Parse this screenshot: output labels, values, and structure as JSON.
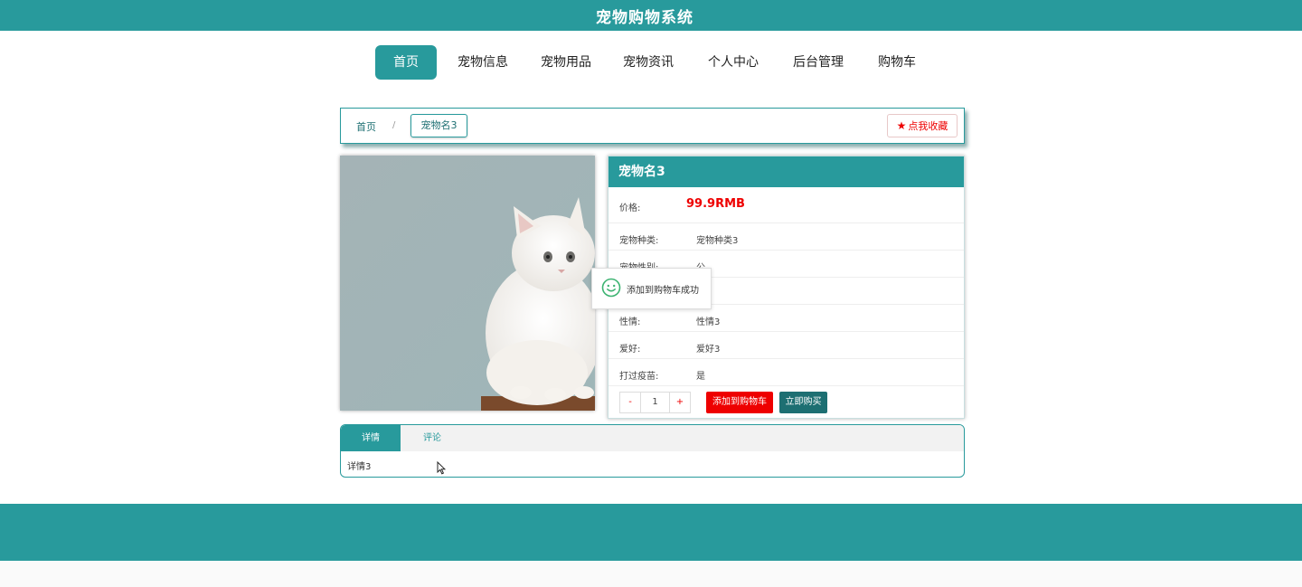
{
  "app": {
    "title": "宠物购物系统"
  },
  "nav": {
    "items": [
      {
        "label": "首页",
        "active": true
      },
      {
        "label": "宠物信息"
      },
      {
        "label": "宠物用品"
      },
      {
        "label": "宠物资讯"
      },
      {
        "label": "个人中心"
      },
      {
        "label": "后台管理"
      },
      {
        "label": "购物车"
      }
    ]
  },
  "breadcrumb": {
    "home": "首页",
    "separator": "/",
    "current": "宠物名3"
  },
  "favorite": {
    "label": "点我收藏",
    "icon": "star-icon"
  },
  "product": {
    "name": "宠物名3",
    "price_label": "价格:",
    "price_value": "99.9RMB",
    "attributes": [
      {
        "key": "宠物种类:",
        "value": "宠物种类3"
      },
      {
        "key": "宠物性别:",
        "value": "公"
      },
      {
        "key": "",
        "value": ""
      },
      {
        "key": "性情:",
        "value": "性情3"
      },
      {
        "key": "爱好:",
        "value": "爱好3"
      },
      {
        "key": "打过疫苗:",
        "value": "是"
      }
    ]
  },
  "quantity": {
    "minus": "-",
    "value": "1",
    "plus": "+"
  },
  "actions": {
    "add_to_cart": "添加到购物车",
    "buy_now": "立即购买"
  },
  "toast": {
    "message": "添加到购物车成功",
    "icon": "smile-icon"
  },
  "tabs": {
    "items": [
      {
        "label": "详情",
        "active": true
      },
      {
        "label": "评论"
      }
    ],
    "content": "详情3"
  },
  "colors": {
    "primary": "#289a9c",
    "accent": "#ee0000",
    "dark_teal": "#1d6f72"
  }
}
